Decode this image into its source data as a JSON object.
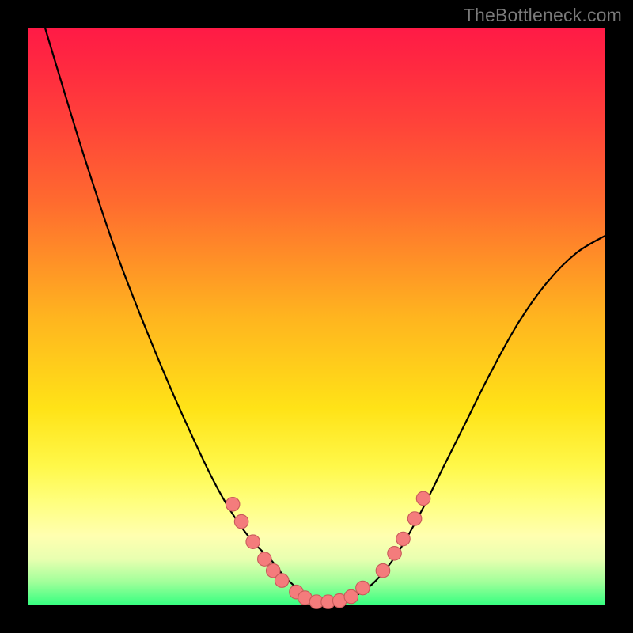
{
  "watermark": "TheBottleneck.com",
  "colors": {
    "frame": "#000000",
    "curve": "#000000",
    "dot_fill": "#f47c7c",
    "dot_stroke": "#c85a5a",
    "gradient_top": "#ff1a46",
    "gradient_bottom": "#34ff80"
  },
  "chart_data": {
    "type": "line",
    "title": "",
    "xlabel": "",
    "ylabel": "",
    "xlim": [
      0,
      100
    ],
    "ylim": [
      0,
      100
    ],
    "series": [
      {
        "name": "curve",
        "x": [
          3,
          6,
          10,
          15,
          20,
          25,
          30,
          33,
          36,
          39,
          42,
          44,
          46,
          48,
          50,
          52,
          54,
          56,
          60,
          64,
          68,
          72,
          76,
          80,
          85,
          90,
          95,
          100
        ],
        "values": [
          100,
          90,
          77,
          62,
          49,
          37,
          26,
          20,
          15,
          11,
          8,
          5.5,
          3.5,
          2,
          1,
          0.5,
          0.5,
          1.2,
          4,
          9,
          16,
          24,
          32,
          40,
          49,
          56,
          61,
          64
        ]
      }
    ],
    "markers": [
      {
        "x": 35.5,
        "y": 17.5
      },
      {
        "x": 37.0,
        "y": 14.5
      },
      {
        "x": 39.0,
        "y": 11.0
      },
      {
        "x": 41.0,
        "y": 8.0
      },
      {
        "x": 42.5,
        "y": 6.0
      },
      {
        "x": 44.0,
        "y": 4.3
      },
      {
        "x": 46.5,
        "y": 2.3
      },
      {
        "x": 48.0,
        "y": 1.3
      },
      {
        "x": 50.0,
        "y": 0.6
      },
      {
        "x": 52.0,
        "y": 0.6
      },
      {
        "x": 54.0,
        "y": 0.8
      },
      {
        "x": 56.0,
        "y": 1.5
      },
      {
        "x": 58.0,
        "y": 3.0
      },
      {
        "x": 61.5,
        "y": 6.0
      },
      {
        "x": 63.5,
        "y": 9.0
      },
      {
        "x": 65.0,
        "y": 11.5
      },
      {
        "x": 67.0,
        "y": 15.0
      },
      {
        "x": 68.5,
        "y": 18.5
      }
    ],
    "marker_radius": 1.2
  }
}
